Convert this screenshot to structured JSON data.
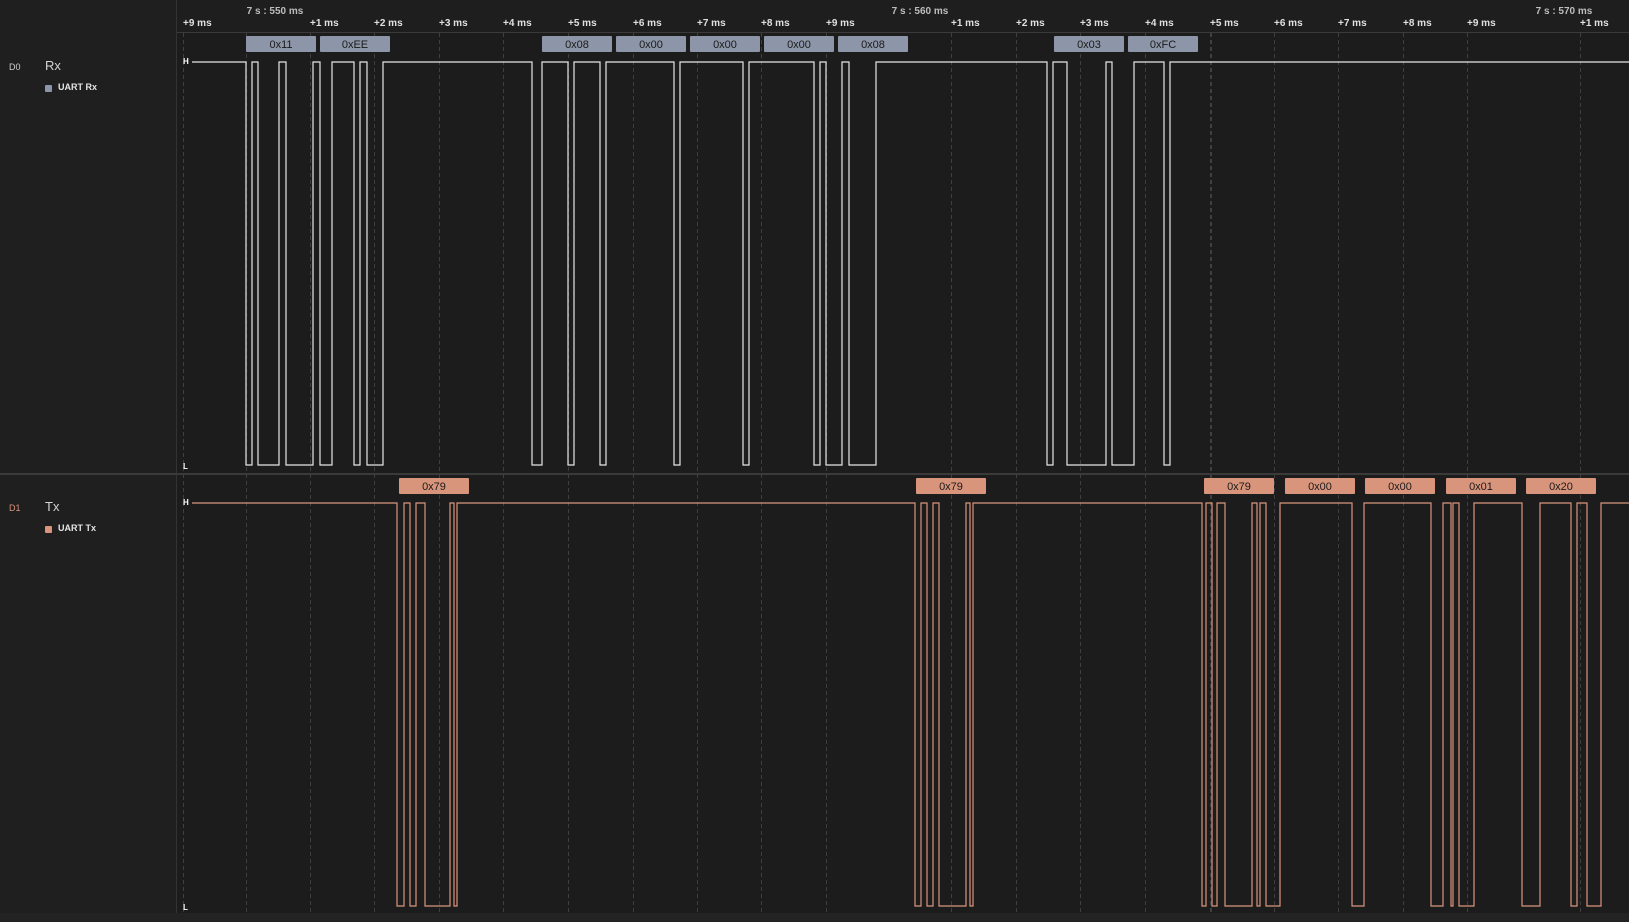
{
  "timeline": {
    "markers": [
      "7 s : 550 ms",
      "7 s : 560 ms",
      "7 s : 570 ms"
    ],
    "ticks": [
      "+9 ms",
      "+1 ms",
      "+2 ms",
      "+3 ms",
      "+4 ms",
      "+5 ms",
      "+6 ms",
      "+7 ms",
      "+8 ms",
      "+9 ms",
      "+1 ms",
      "+2 ms",
      "+3 ms",
      "+4 ms",
      "+5 ms",
      "+6 ms",
      "+7 ms",
      "+8 ms",
      "+9 ms",
      "+1 ms"
    ]
  },
  "channels": [
    {
      "id": "D0",
      "name": "Rx",
      "analyzer": "UART Rx",
      "color": "#8d96a8",
      "level_high": "H",
      "level_low": "L",
      "frames": [
        "0x11",
        "0xEE",
        "0x08",
        "0x00",
        "0x00",
        "0x00",
        "0x08",
        "0x03",
        "0xFC"
      ],
      "edges": [
        246,
        252,
        258,
        279,
        286,
        313,
        320,
        332,
        354,
        360,
        367,
        383,
        532,
        542,
        568,
        574,
        600,
        606,
        674,
        680,
        743,
        749,
        814,
        820,
        826,
        842,
        849,
        876,
        1047,
        1053,
        1067,
        1106,
        1112,
        1134,
        1164,
        1170
      ]
    },
    {
      "id": "D1",
      "name": "Tx",
      "analyzer": "UART Tx",
      "color": "#d9957c",
      "level_high": "H",
      "level_low": "L",
      "frames": [
        "0x79",
        "0x79",
        "0x79",
        "0x00",
        "0x00",
        "0x01",
        "0x20"
      ],
      "edges": [
        397,
        404,
        410,
        416,
        425,
        450,
        454,
        457,
        915,
        921,
        927,
        933,
        939,
        966,
        970,
        973,
        1202,
        1206,
        1212,
        1217,
        1225,
        1252,
        1257,
        1260,
        1266,
        1280,
        1352,
        1364,
        1431,
        1443,
        1451,
        1453,
        1459,
        1474,
        1522,
        1540,
        1571,
        1577,
        1587,
        1601
      ]
    }
  ]
}
